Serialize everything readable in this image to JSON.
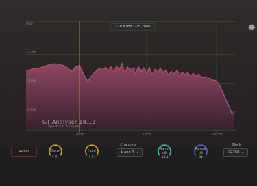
{
  "plot": {
    "db_labels": [
      "0dB",
      "-21dB",
      "-42dB",
      "-63dB"
    ],
    "freq_labels": [
      "100Hz",
      "1kHz",
      "10kHz"
    ],
    "readout": "120.82Hz : -15.26dB",
    "colors": {
      "grid": "#2f7a2f",
      "fill_top": "#9a4a6a",
      "fill_bottom": "#4a2a3a",
      "line_red": "#e05040",
      "line_blue": "#5a5ad8",
      "cursor": "#b0b040"
    }
  },
  "brand": {
    "title": "GT Analyser",
    "version": "18.12",
    "subtitle": "Spectrum Analyser"
  },
  "controls": {
    "reset_label": "Reset",
    "decay": {
      "label": "Decay",
      "value": "4.01",
      "color": "#e0a030"
    },
    "hold": {
      "label": "Hold",
      "value": "3.13",
      "color": "#e0a030"
    },
    "channels": {
      "label": "Channels",
      "value": "L and R"
    },
    "ramp": {
      "label": "Ramp",
      "value": "-14.1",
      "prefix": "dB",
      "color": "#30c0b0"
    },
    "range": {
      "label": "Range",
      "value": "84",
      "prefix": "dB",
      "color": "#4a60e0"
    },
    "block": {
      "label": "Block",
      "value": "32768"
    }
  },
  "icons": {
    "settings": "gear-icon",
    "dropdown": "chevron-down-icon"
  }
}
